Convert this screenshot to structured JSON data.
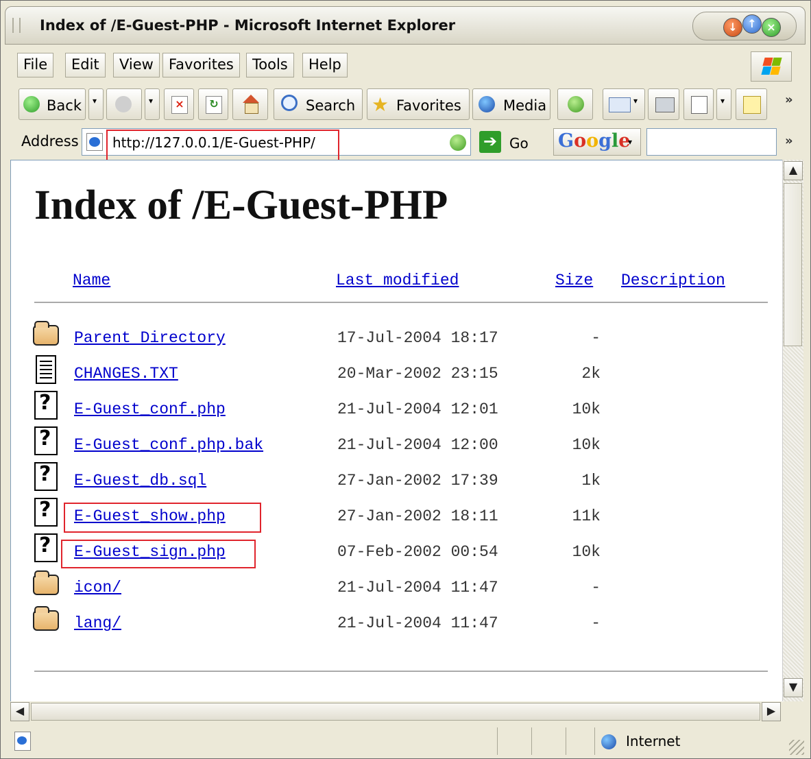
{
  "window": {
    "title": "Index of /E-Guest-PHP - Microsoft Internet Explorer"
  },
  "menu": [
    {
      "label": "File"
    },
    {
      "label": "Edit"
    },
    {
      "label": "View"
    },
    {
      "label": "Favorites"
    },
    {
      "label": "Tools"
    },
    {
      "label": "Help"
    }
  ],
  "toolbar": {
    "back_label": "Back",
    "search_label": "Search",
    "favorites_label": "Favorites",
    "media_label": "Media"
  },
  "address": {
    "label": "Address",
    "url": "http://127.0.0.1/E-Guest-PHP/",
    "go_label": "Go"
  },
  "google": {
    "label": "Google",
    "search_value": ""
  },
  "page": {
    "heading": "Index of /E-Guest-PHP",
    "columns": {
      "name": "Name",
      "last_modified": "Last modified",
      "size": "Size",
      "description": "Description"
    },
    "rows": [
      {
        "name": "Parent Directory",
        "modified": "17-Jul-2004 18:17",
        "size": "-",
        "type": "folder"
      },
      {
        "name": "CHANGES.TXT",
        "modified": "20-Mar-2002 23:15",
        "size": "2k",
        "type": "text"
      },
      {
        "name": "E-Guest_conf.php",
        "modified": "21-Jul-2004 12:01",
        "size": "10k",
        "type": "unknown"
      },
      {
        "name": "E-Guest_conf.php.bak",
        "modified": "21-Jul-2004 12:00",
        "size": "10k",
        "type": "unknown"
      },
      {
        "name": "E-Guest_db.sql",
        "modified": "27-Jan-2002 17:39",
        "size": "1k",
        "type": "unknown"
      },
      {
        "name": "E-Guest_show.php",
        "modified": "27-Jan-2002 18:11",
        "size": "11k",
        "type": "unknown"
      },
      {
        "name": "E-Guest_sign.php",
        "modified": "07-Feb-2002 00:54",
        "size": "10k",
        "type": "unknown"
      },
      {
        "name": "icon/",
        "modified": "21-Jul-2004 11:47",
        "size": "-",
        "type": "folder"
      },
      {
        "name": "lang/",
        "modified": "21-Jul-2004 11:47",
        "size": "-",
        "type": "folder"
      }
    ]
  },
  "status": {
    "zone": "Internet"
  },
  "colors": {
    "link": "#0000cc",
    "annotation": "#e0242c",
    "chrome": "#ece9d8"
  }
}
